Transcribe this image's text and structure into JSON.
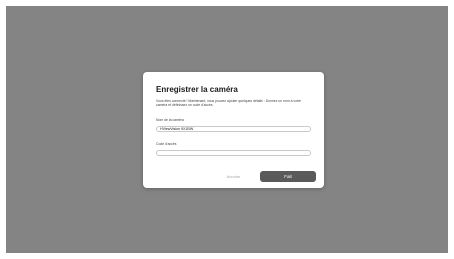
{
  "dialog": {
    "title": "Enregistrer la caméra",
    "description": "Vous êtes connecté ! Maintenant, vous pouvez ajouter quelques détails : Donnez un nom à votre caméra et définissez un code d'accès.",
    "name_label": "Nom de la caméra",
    "name_value": "HViewVision 9X1BW",
    "code_label": "Code d'accès",
    "code_value": "",
    "cancel_label": "Annuler",
    "done_label": "Fait"
  },
  "colors": {
    "backdrop": "#848484",
    "dialog_background": "#ffffff",
    "primary_button": "#5a5a5a",
    "cancel_text": "#a8a8a8"
  }
}
